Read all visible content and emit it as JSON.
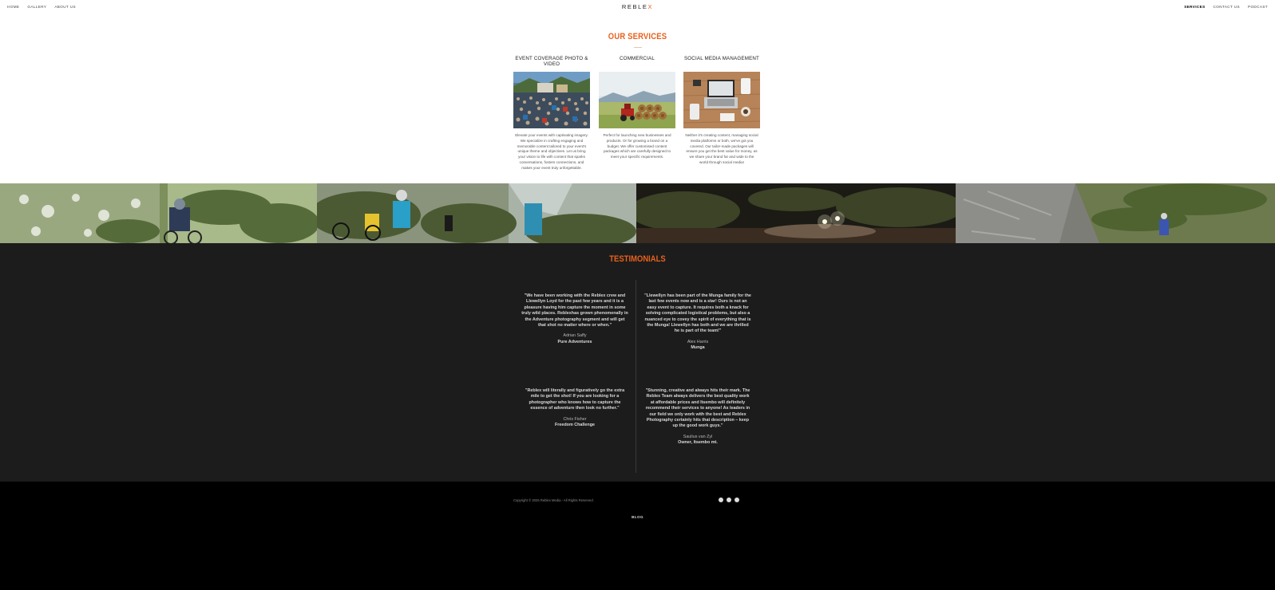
{
  "header": {
    "logo_main": "REBLE",
    "logo_accent": "X",
    "nav_left": [
      "HOME",
      "GALLERY",
      "ABOUT US"
    ],
    "nav_right": [
      "SERVICES",
      "CONTACT US",
      "PODCAST"
    ],
    "active_item": "SERVICES"
  },
  "services": {
    "title": "OUR SERVICES",
    "items": [
      {
        "title": "EVENT COVERAGE PHOTO & VIDEO",
        "description": "Elevate your events with captivating imagery. We specialize in crafting engaging and memorable content tailored to your event's unique theme and objectives. Let us bring your vision to life with content that sparks conversations, fosters connections, and makes your event truly unforgettable."
      },
      {
        "title": "COMMERCIAL",
        "description": "Perfect for launching new businesses and products. Or for growing a brand on a budget. We offer customised content packages which are carefully designed to meet your specific requirements."
      },
      {
        "title": "SOCIAL MEDIA MANAGEMENT",
        "description": "Neither it's creating content, managing social media platforms or both, we've got you covered. Our tailor-made packages will ensure you get the best value for money, as we share your brand far and wide to the world through social media!"
      }
    ]
  },
  "testimonials": {
    "title": "TESTIMONIALS",
    "items": [
      {
        "quote": "\"We have been working with the Reblex crew and Llewellyn Loyd for the past few years and it is a pleasure having him capture the moment in some truly wild places. Reblexhas grown phenomenally in the Adventure photography segment and will get that shot no matter where or when.\"",
        "author": "Adrian Saffy",
        "org": "Pure Adventures"
      },
      {
        "quote": "\"Llewellyn has been part of the Munga family for the last few events now and is a star! Ours is not an easy event to capture. It requires both a knack for solving complicated logistical problems, but also a nuanced eye to covey the spirit of everything that is the Munga! Llewellyn has both and we are thrilled he is part of the team!\"",
        "author": "Alex Harris",
        "org": "Munga"
      },
      {
        "quote": "\"Reblex will literally and figuratively go the extra mile to get the shot! If you are looking for a photographer who knows how to capture the essence of adventure then look no further.\"",
        "author": "Chris Fisher",
        "org": "Freedom Challenge"
      },
      {
        "quote": "\"Stunning, creative and always hits their mark. The Reblex Team always delivers the best quality work at affordable prices and Itsembo will definitely recommend their services to anyone! As leaders in our field we only work with the best and Reblex Photography certainly hits that description – keep up the good work guys.\"",
        "author": "Saulius van Zyl",
        "org": "Owner, Itsembo mt."
      }
    ]
  },
  "footer": {
    "copyright": "Copyright © 2025 Reblex Media - All Rights Reserved.",
    "social_icons": [
      "facebook-icon",
      "instagram-icon",
      "youtube-icon"
    ],
    "blog": "BLOG"
  },
  "colors": {
    "accent": "#e8611c",
    "testimonials_bg": "#1c1c1c",
    "footer_bg": "#000000"
  }
}
